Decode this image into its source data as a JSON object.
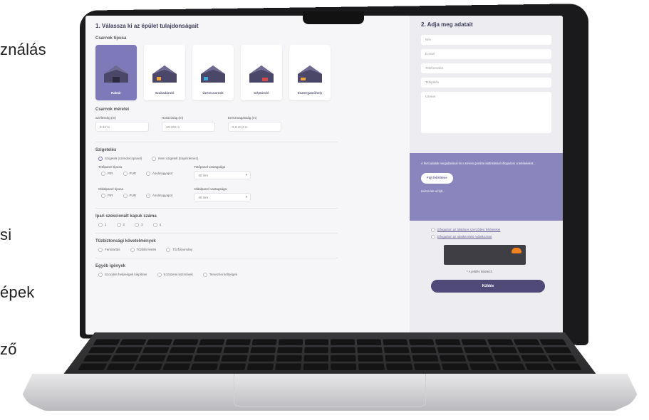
{
  "side_fragments": [
    "ználás",
    "si",
    "épek",
    "ző"
  ],
  "left": {
    "title": "1. Válassza ki az épület tulajdonságait",
    "types_label": "Csarnok típusa",
    "types": [
      "Raktár",
      "Szabadáruló",
      "Üzemcsarnok",
      "Géptároló",
      "Esztergaműhely"
    ],
    "dims_label": "Csarnok méretei",
    "dims": [
      {
        "label": "Szélesség (m)",
        "value": "8-40 m"
      },
      {
        "label": "Hosszúság (m)",
        "value": "10-200 m"
      },
      {
        "label": "Ereszmagasság (m)",
        "value": "3,0-10,2 m"
      }
    ],
    "insulation_label": "Szigetelés",
    "insulation_options": [
      "Szigetelt (szendvicspanel)",
      "Nem szigetelt (trapézlemez)"
    ],
    "roof_panel_label": "Tetőpanel típusa",
    "roof_panel_options": [
      "PIR",
      "PUR",
      "Ásványgyapot"
    ],
    "roof_thickness_label": "Tetőpanel vastagsága",
    "roof_thickness_value": "40 mm",
    "wall_panel_label": "Oldalpanel típusa",
    "wall_panel_options": [
      "PIR",
      "PUR",
      "Ásványgyapot"
    ],
    "wall_thickness_label": "Oldalpanel vastagsága",
    "wall_thickness_value": "40 mm",
    "doors_label": "Ipari szekcionált kapuk száma",
    "doors_options": [
      "1",
      "2",
      "3",
      "4"
    ],
    "fire_label": "Tűzbiztonsági követelmények",
    "fire_options": [
      "Fenntartás",
      "Tűzálló festés",
      "Tűzfolyomány"
    ],
    "other_label": "Egyéb igények",
    "other_options": [
      "Szociális helyiségek kiépítése",
      "Közüzemi közművek",
      "Tervezési költségek"
    ]
  },
  "right": {
    "title": "2. Adja meg adatait",
    "fields": [
      "Név",
      "E-mail",
      "Telefonszám",
      "Település",
      "Üzenet"
    ],
    "info_text": "A fenti adatok megadásával és a Kérem gombra kattintással elfogadom a feltételeket...",
    "upload_button": "Fájl feltöltése",
    "upload_hint": "Húzza ide a fájlt...",
    "consent_1": "Elfogadom az általános szerződési feltételeket",
    "consent_2": "Elfogadom az adatkezelési nyilatkozatot",
    "note": "* A jelölés kötelező",
    "submit": "Küldés"
  }
}
